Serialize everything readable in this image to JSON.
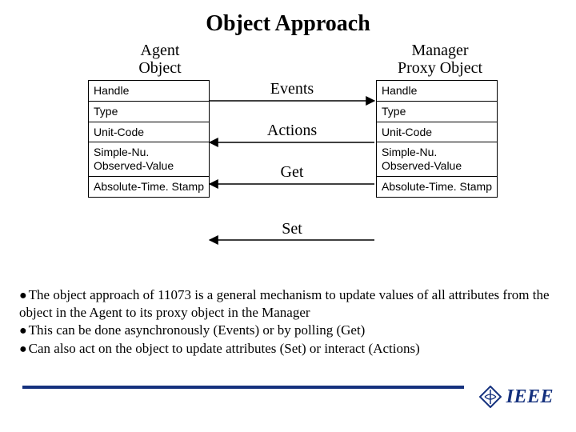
{
  "title": "Object Approach",
  "agent": {
    "heading_line1": "Agent",
    "heading_line2": "Object",
    "rows": [
      "Handle",
      "Type",
      "Unit-Code",
      "Simple-Nu. Observed-Value",
      "Absolute-Time. Stamp"
    ]
  },
  "manager": {
    "heading_line1": "Manager",
    "heading_line2": "Proxy Object",
    "rows": [
      "Handle",
      "Type",
      "Unit-Code",
      "Simple-Nu. Observed-Value",
      "Absolute-Time. Stamp"
    ]
  },
  "arrows": {
    "events": "Events",
    "actions": "Actions",
    "get": "Get",
    "set": "Set"
  },
  "bullets": [
    "The object approach of 11073 is a general mechanism to update values of all attributes from the object in the Agent to its proxy object in the Manager",
    "This can be done asynchronously (Events) or by polling (Get)",
    "Can also act on the object to update attributes (Set) or interact (Actions)"
  ],
  "logo_text": "IEEE"
}
